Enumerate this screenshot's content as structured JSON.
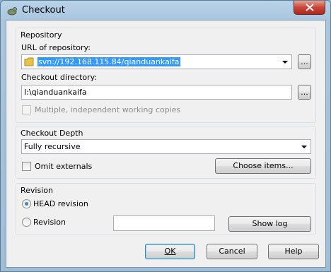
{
  "window": {
    "title": "Checkout",
    "close_symbol": "✕"
  },
  "repository": {
    "group_title": "Repository",
    "url_label": "URL of repository:",
    "url_value": "svn://192.168.115.84/qianduankaifa",
    "browse_label": "...",
    "dir_label": "Checkout directory:",
    "dir_value": "I:\\qianduankaifa",
    "multi_label": "Multiple, independent working copies"
  },
  "depth": {
    "group_title": "Checkout Depth",
    "selected": "Fully recursive",
    "omit_label": "Omit externals",
    "choose_label": "Choose items..."
  },
  "revision": {
    "group_title": "Revision",
    "head_label": "HEAD revision",
    "rev_label": "Revision",
    "rev_value": "",
    "showlog_label": "Show log"
  },
  "buttons": {
    "ok": "OK",
    "cancel": "Cancel",
    "help": "Help"
  },
  "colors": {
    "selection": "#3399ff",
    "close": "#c7463a",
    "frame": "#a9c6de"
  }
}
